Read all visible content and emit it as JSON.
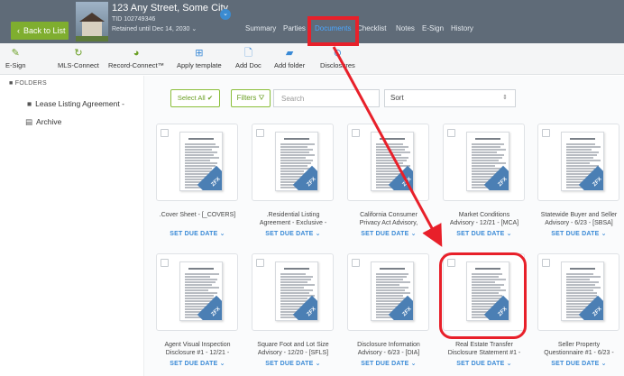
{
  "header": {
    "back_label": "Back to List",
    "address": "123 Any Street, Some City",
    "tid": "TID 102749346",
    "retained": "Retained until Dec 14, 2030",
    "tabs": [
      "Summary",
      "Parties",
      "Documents",
      "Checklist",
      "Notes",
      "E-Sign",
      "History"
    ],
    "active_tab": "Documents"
  },
  "toolbar": {
    "items": [
      "E-Sign",
      "MLS-Connect",
      "Record-Connect™",
      "Apply template",
      "Add Doc",
      "Add folder",
      "Disclosures"
    ]
  },
  "sidebar": {
    "heading": "FOLDERS",
    "folders": [
      "Lease Listing Agreement -",
      "Archive"
    ]
  },
  "controls": {
    "select_all": "Select All",
    "filters": "Filters",
    "search_placeholder": "Search",
    "sort_label": "Sort"
  },
  "documents": [
    {
      "title1": ".Cover Sheet - [_COVERS]",
      "title2": "",
      "due": "SET DUE DATE"
    },
    {
      "title1": ".Residential Listing",
      "title2": "Agreement - Exclusive -",
      "due": "SET DUE DATE"
    },
    {
      "title1": "California Consumer",
      "title2": "Privacy Act Advisory,",
      "due": "SET DUE DATE"
    },
    {
      "title1": "Market Conditions",
      "title2": "Advisory - 12/21 - [MCA]",
      "due": "SET DUE DATE"
    },
    {
      "title1": "Statewide Buyer and Seller",
      "title2": "Advisory - 6/23 - [SBSA]",
      "due": "SET DUE DATE"
    },
    {
      "title1": "Agent Visual Inspection",
      "title2": "Disclosure #1 - 12/21 -",
      "due": "SET DUE DATE"
    },
    {
      "title1": "Square Foot and Lot Size",
      "title2": "Advisory - 12/20 - [SFLS]",
      "due": "SET DUE DATE"
    },
    {
      "title1": "Disclosure Information",
      "title2": "Advisory - 6/23 - [DIA]",
      "due": "SET DUE DATE"
    },
    {
      "title1": "Real Estate Transfer",
      "title2": "Disclosure Statement #1 -",
      "due": "SET DUE DATE"
    },
    {
      "title1": "Seller Property",
      "title2": "Questionnaire #1 - 6/23 -",
      "due": "SET DUE DATE"
    }
  ],
  "badge_text": "ZFX",
  "colors": {
    "header_bg": "#5f6b78",
    "accent_green": "#7fae2f",
    "active_tab": "#4aa6ff",
    "link_blue": "#3a8ad6",
    "highlight_red": "#e8202a"
  }
}
